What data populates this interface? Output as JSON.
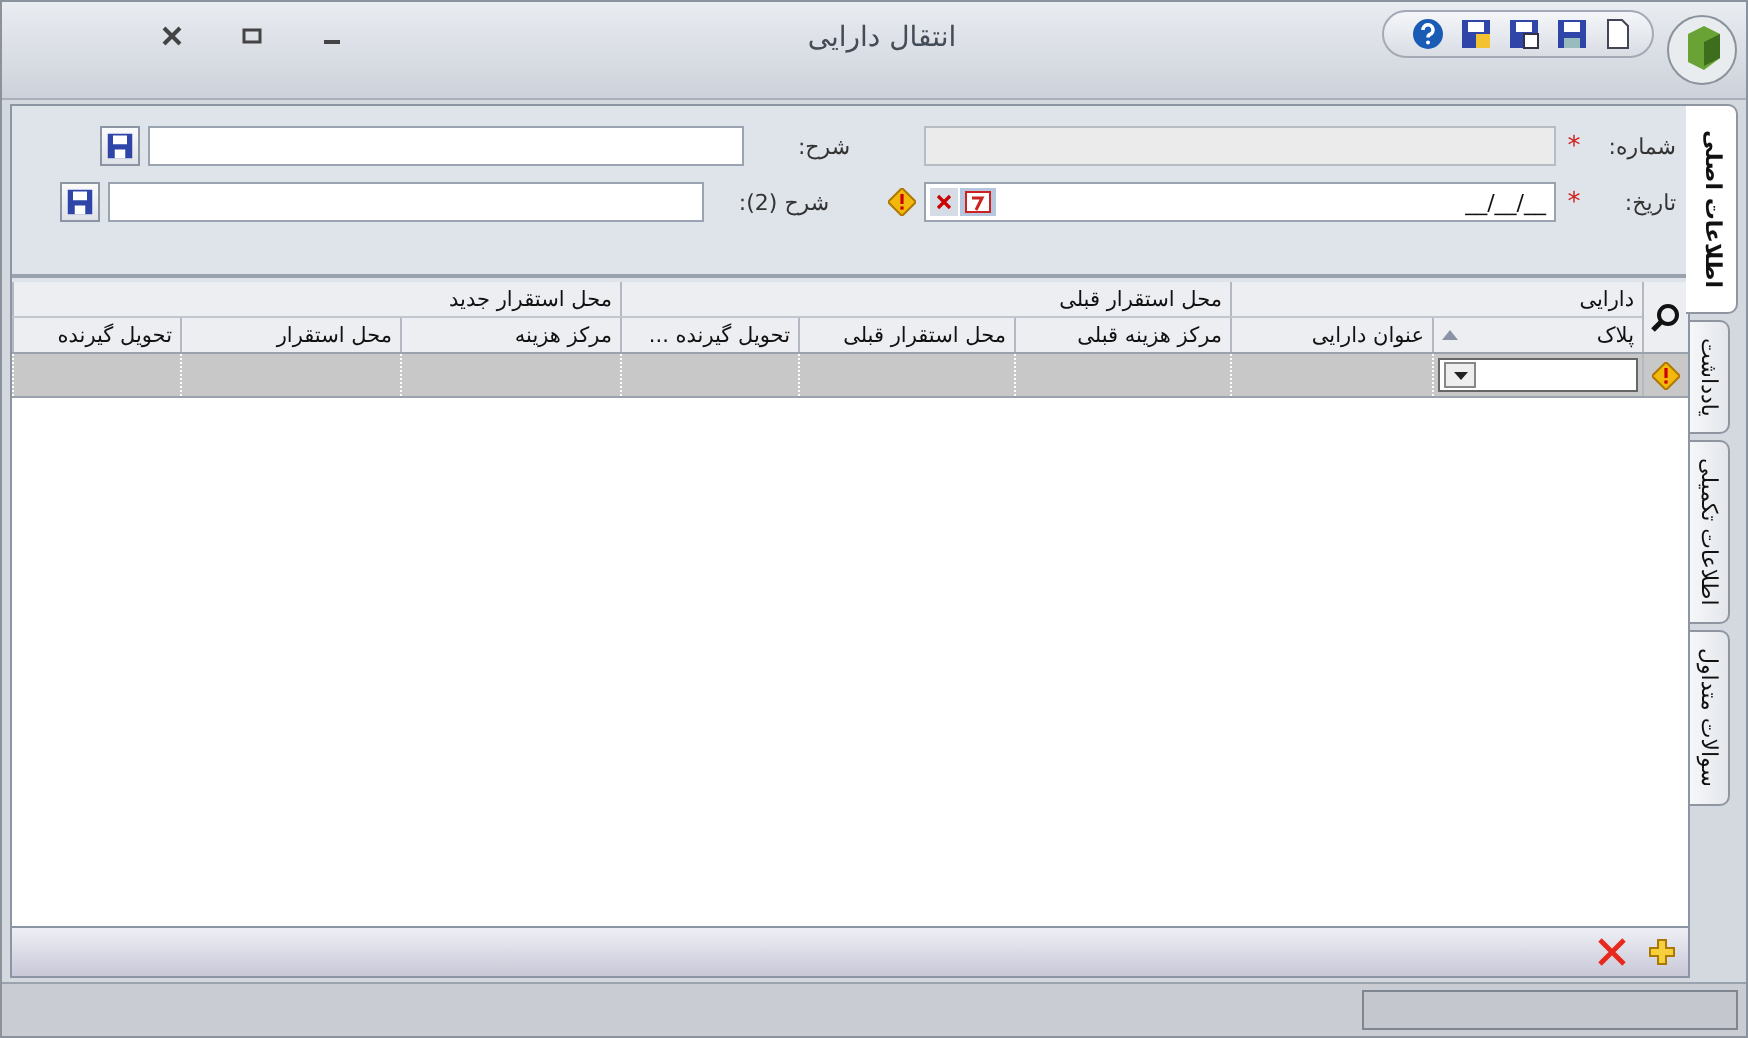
{
  "window": {
    "title": "انتقال دارایی"
  },
  "form": {
    "number": {
      "label": "شماره:",
      "required_mark": "*",
      "disabled": true
    },
    "date": {
      "label": "تاریخ:",
      "required_mark": "*",
      "value": "__/__/__"
    },
    "descriptions": [
      {
        "label": "شرح:"
      },
      {
        "label": "شرح (2):"
      }
    ]
  },
  "grid": {
    "groups": [
      {
        "label": "دارایی",
        "columns": [
          {
            "label": "پلاک",
            "sorted": true
          },
          {
            "label": "عنوان دارایی",
            "sorted": false
          }
        ]
      },
      {
        "label": "محل استقرار قبلی",
        "columns": [
          {
            "label": "مرکز هزینه قبلی",
            "sorted": false
          },
          {
            "label": "محل استقرار قبلی",
            "sorted": false
          },
          {
            "label": "تحویل گیرنده ...",
            "sorted": false
          }
        ]
      },
      {
        "label": "محل استقرار جدید",
        "columns": [
          {
            "label": "مرکز هزینه",
            "sorted": false
          },
          {
            "label": "محل استقرار",
            "sorted": false
          },
          {
            "label": "تحویل گیرنده",
            "sorted": false
          }
        ]
      }
    ],
    "rows": [
      {
        "selected": true
      }
    ]
  },
  "tabs": [
    {
      "label": "اطلاعات اصلی",
      "selected": true
    },
    {
      "label": "یادداشت",
      "selected": false
    },
    {
      "label": "اطلاعات تکمیلی",
      "selected": false
    },
    {
      "label": "سوالات متداول",
      "selected": false
    }
  ]
}
